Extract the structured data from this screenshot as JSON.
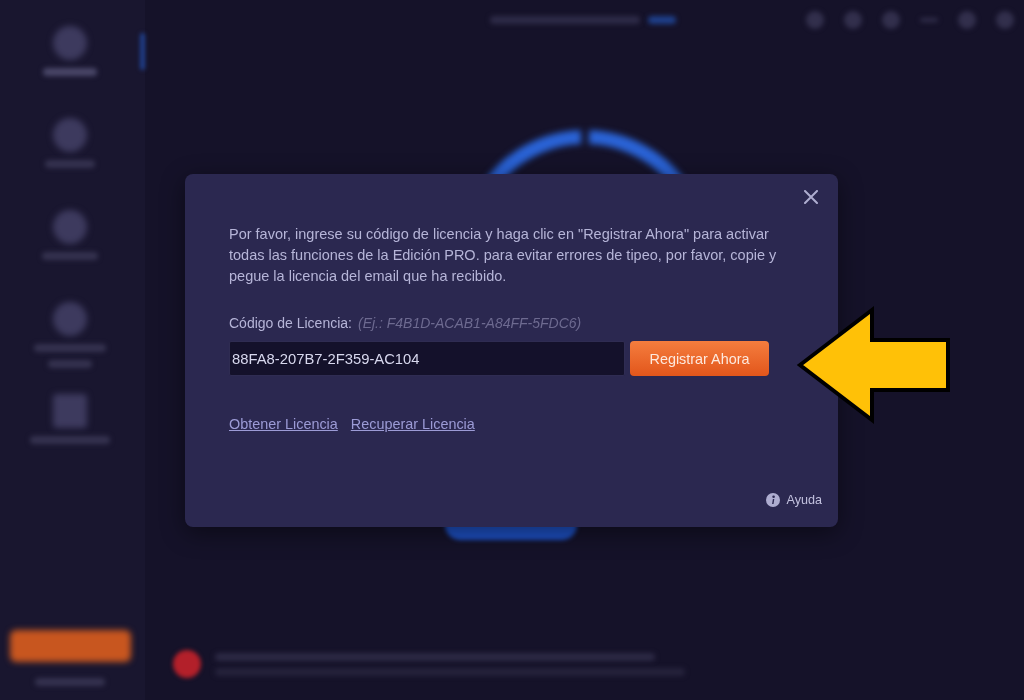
{
  "dialog": {
    "message": "Por favor, ingrese su código de licencia y haga clic en \"Registrar Ahora\" para activar todas las funciones de la Edición PRO. para evitar errores de tipeo, por favor, copie y pegue la licencia del email que ha recibido.",
    "license_field": {
      "label": "Código de Licencia:",
      "hint": "(Ej.: F4B1D-ACAB1-A84FF-5FDC6)",
      "value": "88FA8-207B7-2F359-AC104"
    },
    "register_button": "Registrar Ahora",
    "links": [
      "Obtener Licencia",
      "Recuperar Licencia"
    ],
    "help": "Ayuda"
  }
}
